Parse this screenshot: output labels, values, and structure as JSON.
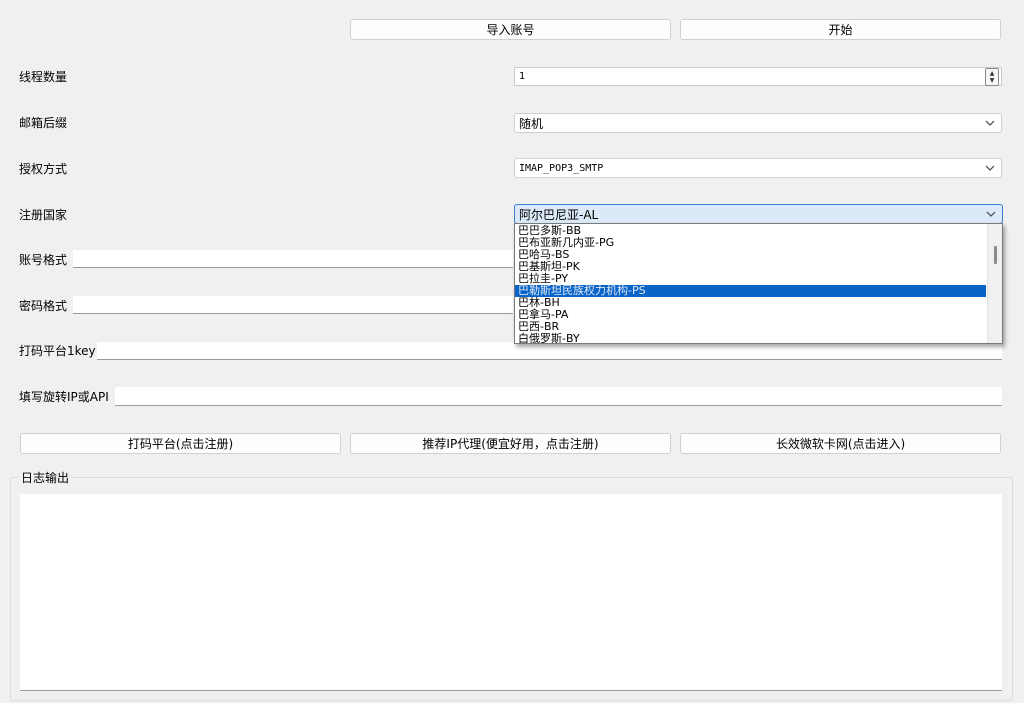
{
  "toolbar": {
    "import_label": "导入账号",
    "start_label": "开始"
  },
  "form": {
    "threads_label": "线程数量",
    "threads_value": "1",
    "email_suffix_label": "邮箱后缀",
    "email_suffix_value": "随机",
    "auth_method_label": "授权方式",
    "auth_method_value": "IMAP_POP3_SMTP",
    "country_label": "注册国家",
    "country_value": "阿尔巴尼亚-AL",
    "account_format_label": "账号格式",
    "account_format_value": "",
    "password_format_label": "密码格式",
    "password_format_value": "",
    "captcha_label": "打码平台1key",
    "captcha_value": "",
    "proxy_label": "填写旋转IP或API",
    "proxy_value": ""
  },
  "country_dropdown": {
    "items": [
      "巴巴多斯-BB",
      "巴布亚新几内亚-PG",
      "巴哈马-BS",
      "巴基斯坦-PK",
      "巴拉圭-PY",
      "巴勒斯坦民族权力机构-PS",
      "巴林-BH",
      "巴拿马-PA",
      "巴西-BR",
      "白俄罗斯-BY"
    ],
    "selected_index": 5
  },
  "links": {
    "captcha_register_label": "打码平台(点击注册)",
    "proxy_recommend_label": "推荐IP代理(便宜好用，点击注册)",
    "card_shop_label": "长效微软卡网(点击进入)"
  },
  "log": {
    "title": "日志输出",
    "content": ""
  },
  "colors": {
    "background": "#f0f0f0",
    "selection": "#0a64c8",
    "focus_border": "#3c7fd0"
  }
}
